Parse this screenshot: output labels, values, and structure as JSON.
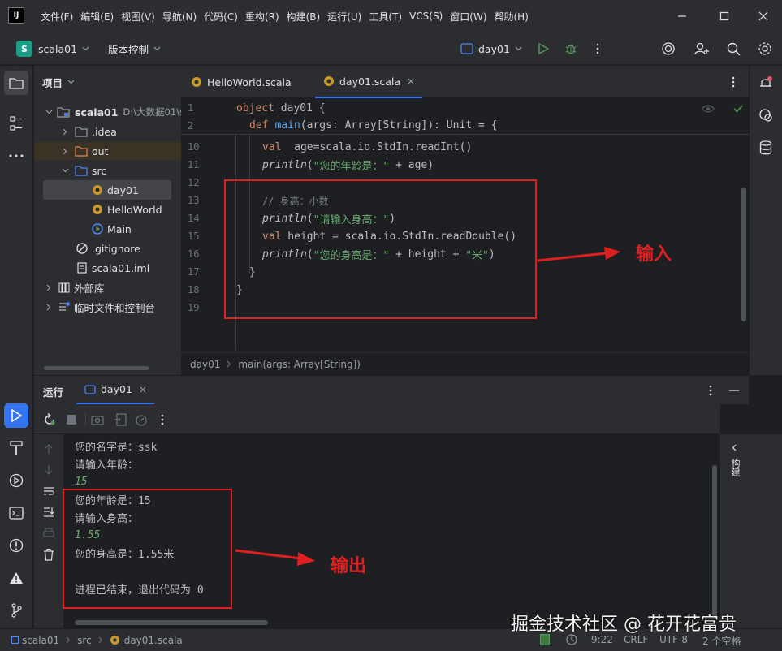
{
  "menu": [
    "文件(F)",
    "编辑(E)",
    "视图(V)",
    "导航(N)",
    "代码(C)",
    "重构(R)",
    "构建(B)",
    "运行(U)",
    "工具(T)",
    "VCS(S)",
    "窗口(W)",
    "帮助(H)"
  ],
  "app_logo": "IJ",
  "project_badge": "S",
  "project_name": "scala01",
  "vcs_label": "版本控制",
  "run_config": "day01",
  "project_panel": {
    "title": "项目",
    "root_name": "scala01",
    "root_path": "D:\\大数据01\\sc",
    "items": [
      {
        "label": "idea",
        "prefix": "."
      },
      {
        "label": "out"
      },
      {
        "label": "src"
      },
      {
        "label": "day01"
      },
      {
        "label": "HelloWorld"
      },
      {
        "label": "Main"
      },
      {
        "label": ".gitignore"
      },
      {
        "label": "scala01.iml"
      },
      {
        "label": "外部库"
      },
      {
        "label": "临时文件和控制台"
      }
    ]
  },
  "tabs": [
    {
      "label": "HelloWorld.scala"
    },
    {
      "label": "day01.scala"
    }
  ],
  "code": {
    "sticky1_ln": "1",
    "sticky1_a": "object",
    "sticky1_b": " day01 {",
    "sticky2_ln": "2",
    "sticky2_a": "def",
    "sticky2_b": "main",
    "sticky2_c": "(args: Array[String]): Unit = {",
    "l10_ln": "10",
    "l10_a": "val",
    "l10_b": "  age=scala.io.StdIn.readInt()",
    "l11_ln": "11",
    "l11_a": "println",
    "l11_b": "(",
    "l11_c": "\"您的年龄是：\"",
    "l11_d": " + age)",
    "l12_ln": "12",
    "l13_ln": "13",
    "l13_a": "// 身高：小数",
    "l14_ln": "14",
    "l14_a": "println",
    "l14_b": "(",
    "l14_c": "\"请输入身高：\"",
    "l14_d": ")",
    "l15_ln": "15",
    "l15_a": "val",
    "l15_b": " height = scala.io.StdIn.readDouble()",
    "l16_ln": "16",
    "l16_a": "println",
    "l16_b": "(",
    "l16_c": "\"您的身高是：\"",
    "l16_d": " + height + ",
    "l16_e": "\"米\"",
    "l16_f": ")",
    "l17_ln": "17",
    "l17_a": "}",
    "l18_ln": "18",
    "l18_a": "}",
    "l19_ln": "19"
  },
  "breadcrumb": [
    "day01",
    "main(args: Array[String])"
  ],
  "run_panel": {
    "title": "运行",
    "tab": "day01"
  },
  "console": {
    "l1": "您的名字是：ssk",
    "l2": "请输入年龄：",
    "l3": "15",
    "l4": "您的年龄是：15",
    "l5": "请输入身高：",
    "l6": "1.55",
    "l7": "您的身高是：1.55米",
    "l8": "进程已结束，退出代码为 0"
  },
  "right_vertical_label": "构建",
  "annotations": {
    "input": "输入",
    "output": "输出"
  },
  "watermark": "掘金技术社区 @ 花开花富贵",
  "status": {
    "path": [
      "scala01",
      "src",
      "day01.scala"
    ],
    "position": "9:22",
    "line_sep": "CRLF",
    "encoding": "UTF-8",
    "indent": "2 个空格"
  },
  "colors": {
    "accent": "#3574f0",
    "annotation": "#e02020",
    "run_green": "#57965c"
  }
}
